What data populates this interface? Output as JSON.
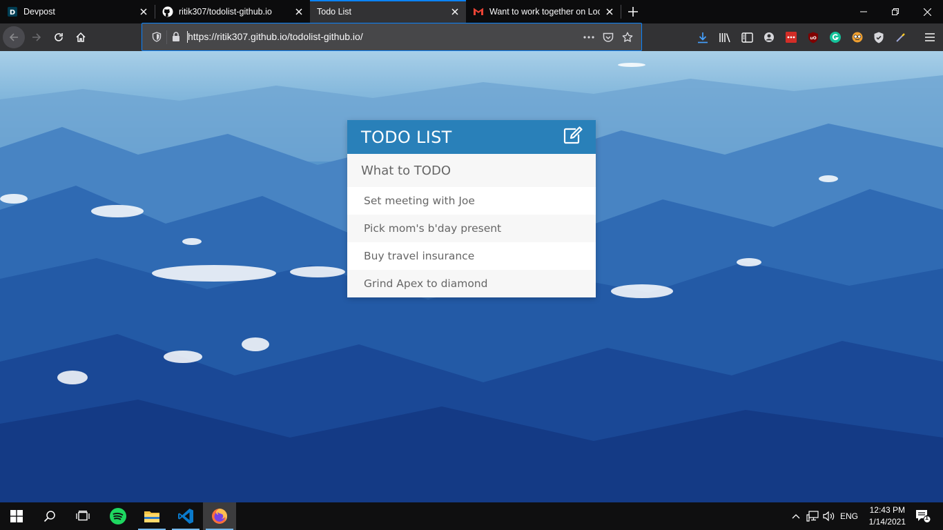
{
  "browser": {
    "tabs": [
      {
        "title": "Devpost",
        "favicon": "devpost-icon",
        "active": false
      },
      {
        "title": "ritik307/todolist-github.io",
        "favicon": "github-icon",
        "active": false
      },
      {
        "title": "Todo List",
        "favicon": "none",
        "active": true
      },
      {
        "title": "Want to work together on Loca",
        "favicon": "gmail-icon",
        "active": false
      }
    ],
    "url": "https://ritik307.github.io/todolist-github.io/",
    "accent_color": "#0a84ff"
  },
  "todo": {
    "title": "TODO LIST",
    "input_placeholder": "What to TODO",
    "items": [
      "Set meeting with Joe",
      "Pick mom's b'day present",
      "Buy travel insurance",
      "Grind Apex to diamond"
    ],
    "header_color": "#2980b9"
  },
  "taskbar": {
    "language": "ENG",
    "time": "12:43 PM",
    "date": "1/14/2021",
    "notification_count": "1"
  }
}
